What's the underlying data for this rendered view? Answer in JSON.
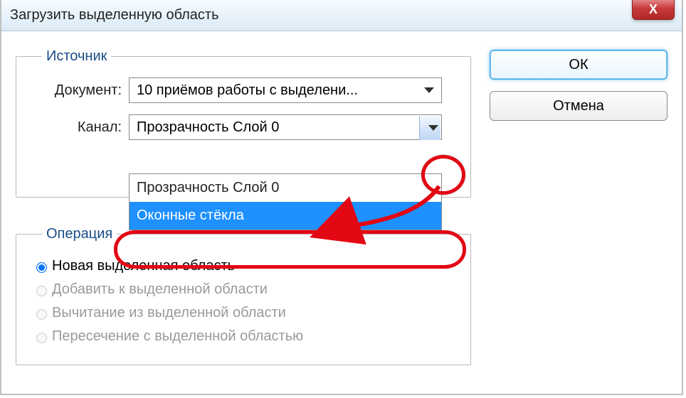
{
  "window": {
    "title": "Загрузить выделенную область",
    "close_icon": "X"
  },
  "source": {
    "legend": "Источник",
    "document_label": "Документ:",
    "document_value": "10 приёмов работы с выделени...",
    "channel_label": "Канал:",
    "channel_value": "Прозрачность Слой 0",
    "channel_options": [
      {
        "label": "Прозрачность Слой 0",
        "selected": false
      },
      {
        "label": "Оконные стёкла",
        "selected": true
      }
    ]
  },
  "operation": {
    "legend": "Операция",
    "options": [
      {
        "label": "Новая выделенная область",
        "checked": true,
        "enabled": true
      },
      {
        "label": "Добавить к выделенной области",
        "checked": false,
        "enabled": false
      },
      {
        "label": "Вычитание из выделенной области",
        "checked": false,
        "enabled": false
      },
      {
        "label": "Пересечение с выделенной областью",
        "checked": false,
        "enabled": false
      }
    ]
  },
  "buttons": {
    "ok": "ОК",
    "cancel": "Отмена"
  }
}
